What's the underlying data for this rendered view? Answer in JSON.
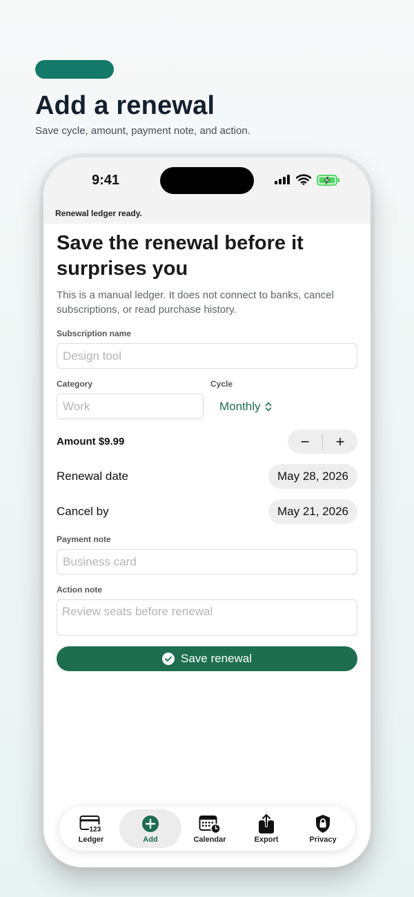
{
  "hero": {
    "title": "Add a renewal",
    "subtitle": "Save cycle, amount, payment note, and action."
  },
  "status_bar": {
    "time": "9:41"
  },
  "banner": "Renewal ledger ready.",
  "form": {
    "title": "Save the renewal before it surprises you",
    "description": "This is a manual ledger. It does not connect to banks, cancel subscriptions, or read purchase history.",
    "subscription_name": {
      "label": "Subscription name",
      "placeholder": "Design tool"
    },
    "category": {
      "label": "Category",
      "placeholder": "Work"
    },
    "cycle": {
      "label": "Cycle",
      "value": "Monthly"
    },
    "amount": {
      "label": "Amount $9.99",
      "decrement": "−",
      "increment": "+"
    },
    "renewal_date": {
      "label": "Renewal date",
      "value": "May 28, 2026"
    },
    "cancel_by": {
      "label": "Cancel by",
      "value": "May 21, 2026"
    },
    "payment_note": {
      "label": "Payment note",
      "placeholder": "Business card"
    },
    "action_note": {
      "label": "Action note",
      "placeholder": "Review seats before renewal"
    },
    "save_button": "Save renewal"
  },
  "tabbar": {
    "active": "Add",
    "items": [
      {
        "label": "Ledger",
        "icon": "ledger-card-123-icon"
      },
      {
        "label": "Add",
        "icon": "plus-circle-icon"
      },
      {
        "label": "Calendar",
        "icon": "calendar-clock-icon"
      },
      {
        "label": "Export",
        "icon": "share-up-icon"
      },
      {
        "label": "Privacy",
        "icon": "lock-shield-icon"
      }
    ]
  },
  "colors": {
    "accent": "#1c6e4f",
    "hero_pill": "#137a6a",
    "battery_green": "#4cd964"
  }
}
